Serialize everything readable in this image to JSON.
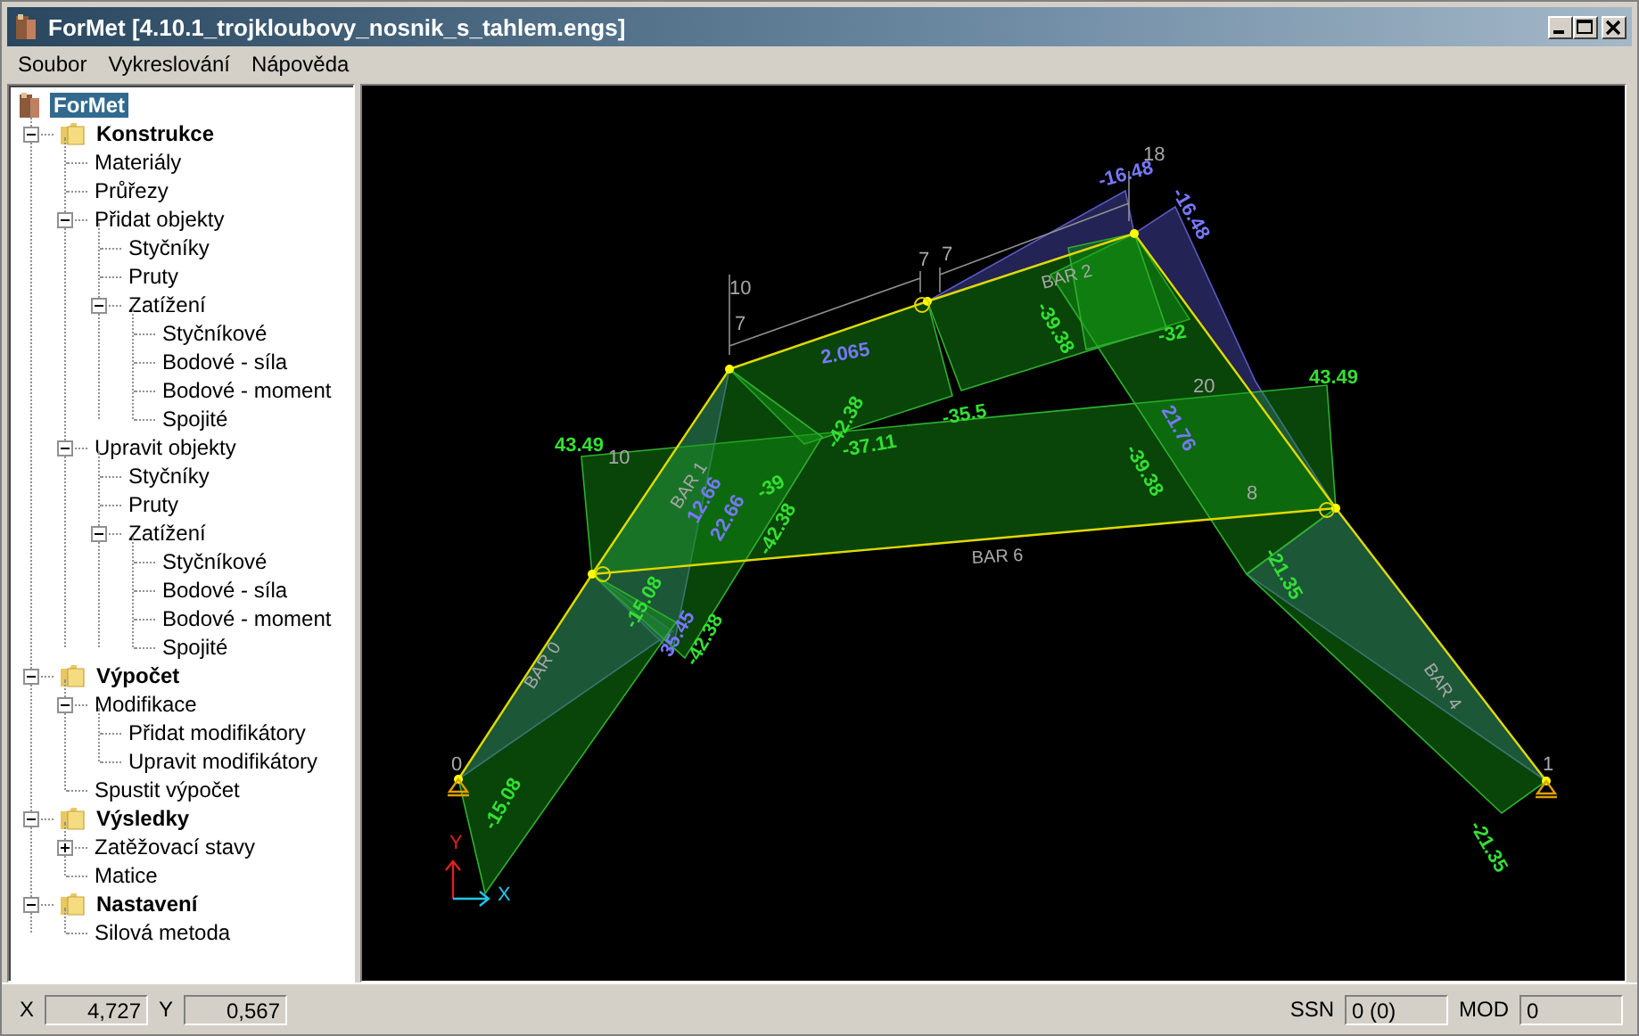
{
  "window": {
    "title": "ForMet [4.10.1_trojkloubovy_nosnik_s_tahlem.engs]"
  },
  "menu": [
    "Soubor",
    "Vykreslování",
    "Nápověda"
  ],
  "tree": {
    "label": "ForMet",
    "selected": true,
    "children": [
      {
        "label": "Konstrukce",
        "selected": false,
        "expanded": true,
        "children": [
          {
            "label": "Materiály",
            "selected": false
          },
          {
            "label": "Průřezy",
            "selected": false
          },
          {
            "label": "Přidat objekty",
            "selected": false,
            "expanded": true,
            "children": [
              {
                "label": "Styčníky",
                "selected": false
              },
              {
                "label": "Pruty",
                "selected": false
              },
              {
                "label": "Zatížení",
                "selected": false,
                "expanded": true,
                "children": [
                  {
                    "label": "Styčníkové",
                    "selected": false
                  },
                  {
                    "label": "Bodové - síla",
                    "selected": false
                  },
                  {
                    "label": "Bodové - moment",
                    "selected": false
                  },
                  {
                    "label": "Spojité",
                    "selected": false
                  }
                ]
              }
            ]
          },
          {
            "label": "Upravit objekty",
            "selected": false,
            "expanded": true,
            "children": [
              {
                "label": "Styčníky",
                "selected": false
              },
              {
                "label": "Pruty",
                "selected": false
              },
              {
                "label": "Zatížení",
                "selected": false,
                "expanded": true,
                "children": [
                  {
                    "label": "Styčníkové",
                    "selected": false
                  },
                  {
                    "label": "Bodové - síla",
                    "selected": false
                  },
                  {
                    "label": "Bodové - moment",
                    "selected": false
                  },
                  {
                    "label": "Spojité",
                    "selected": false
                  }
                ]
              }
            ]
          }
        ]
      },
      {
        "label": "Výpočet",
        "selected": false,
        "expanded": true,
        "children": [
          {
            "label": "Modifikace",
            "selected": false,
            "expanded": true,
            "children": [
              {
                "label": "Přidat modifikátory",
                "selected": false
              },
              {
                "label": "Upravit modifikátory",
                "selected": false
              }
            ]
          },
          {
            "label": "Spustit výpočet",
            "selected": false
          }
        ]
      },
      {
        "label": "Výsledky",
        "selected": false,
        "expanded": true,
        "children": [
          {
            "label": "Zatěžovací stavy",
            "selected": false,
            "expanded": false
          },
          {
            "label": "Matice",
            "selected": false
          }
        ]
      },
      {
        "label": "Nastavení",
        "selected": false,
        "expanded": true,
        "children": [
          {
            "label": "Silová metoda",
            "selected": false
          }
        ]
      }
    ]
  },
  "canvas": {
    "labels": [
      {
        "text": "18",
        "kind": "node"
      },
      {
        "text": "10",
        "kind": "node"
      },
      {
        "text": "7",
        "kind": "node"
      },
      {
        "text": "7",
        "kind": "node"
      },
      {
        "text": "7",
        "kind": "node"
      },
      {
        "text": "10",
        "kind": "node"
      },
      {
        "text": "8",
        "kind": "node"
      },
      {
        "text": "0",
        "kind": "node"
      },
      {
        "text": "1",
        "kind": "node"
      },
      {
        "text": "20",
        "kind": "node"
      },
      {
        "text": "BAR 0",
        "kind": "bar"
      },
      {
        "text": "BAR 1",
        "kind": "bar"
      },
      {
        "text": "BAR 2",
        "kind": "bar"
      },
      {
        "text": "BAR 4",
        "kind": "bar"
      },
      {
        "text": "BAR 6",
        "kind": "bar"
      },
      {
        "text": "43.49",
        "kind": "moment"
      },
      {
        "text": "43.49",
        "kind": "moment"
      },
      {
        "text": "-35.5",
        "kind": "moment"
      },
      {
        "text": "-37.11",
        "kind": "moment"
      },
      {
        "text": "-42.38",
        "kind": "moment"
      },
      {
        "text": "-39",
        "kind": "moment"
      },
      {
        "text": "-42.38",
        "kind": "moment"
      },
      {
        "text": "12.66",
        "kind": "shear"
      },
      {
        "text": "22.66",
        "kind": "shear"
      },
      {
        "text": "-15.08",
        "kind": "moment"
      },
      {
        "text": "35.45",
        "kind": "shear"
      },
      {
        "text": "-42.38",
        "kind": "moment"
      },
      {
        "text": "-15.08",
        "kind": "moment"
      },
      {
        "text": "2.065",
        "kind": "shear"
      },
      {
        "text": "-39.38",
        "kind": "moment"
      },
      {
        "text": "-39.38",
        "kind": "moment"
      },
      {
        "text": "-32",
        "kind": "moment"
      },
      {
        "text": "21.76",
        "kind": "shear"
      },
      {
        "text": "-21.35",
        "kind": "moment"
      },
      {
        "text": "-21.35",
        "kind": "moment"
      },
      {
        "text": "-16.48",
        "kind": "shear"
      },
      {
        "text": "-16.48",
        "kind": "shear"
      },
      {
        "text": "Y",
        "kind": "axis-y"
      },
      {
        "text": "X",
        "kind": "axis-x"
      }
    ]
  },
  "status_bar": {
    "x_label": "X",
    "x_value": "4,727",
    "y_label": "Y",
    "y_value": "0,567",
    "ssn_label": "SSN",
    "ssn_value": "0 (0)",
    "mod_label": "MOD",
    "mod_value": "0"
  }
}
